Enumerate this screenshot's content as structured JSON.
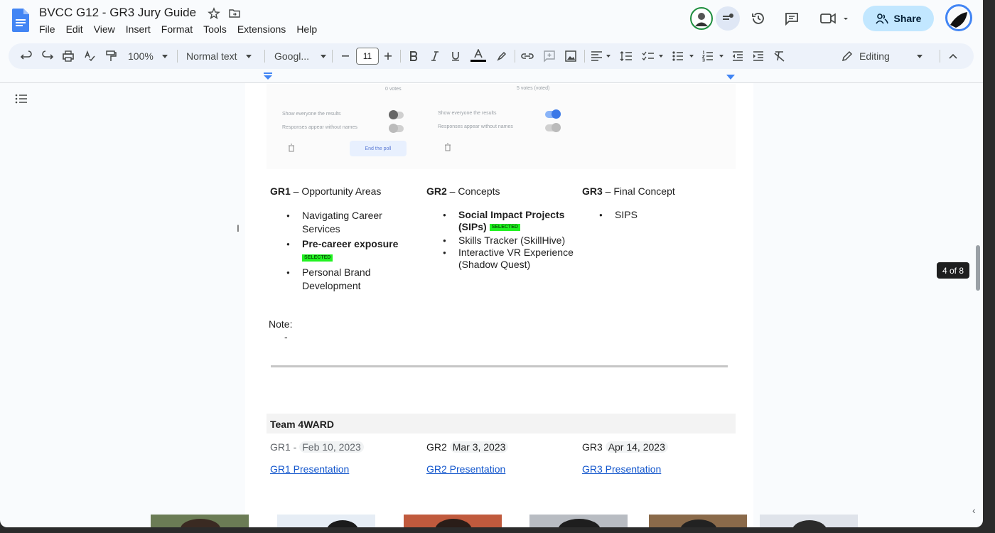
{
  "document": {
    "title": "BVCC G12  - GR3 Jury Guide",
    "menu": [
      "File",
      "Edit",
      "View",
      "Insert",
      "Format",
      "Tools",
      "Extensions",
      "Help"
    ]
  },
  "header": {
    "share_label": "Share"
  },
  "toolbar": {
    "zoom": "100%",
    "style": "Normal text",
    "font": "Googl...",
    "font_size": "11",
    "mode": "Editing"
  },
  "poll": {
    "left_top_label": "0 votes",
    "right_top_label": "5 votes (voted)",
    "left_opt1": "Show everyone the results",
    "left_opt2": "Responses appear without names",
    "right_opt1": "Show everyone the results",
    "right_opt2": "Responses appear without names",
    "end_poll_label": "End the poll"
  },
  "rounds": {
    "gr1": {
      "code": "GR1",
      "title": " – Opportunity Areas",
      "items": [
        {
          "text": "Navigating Career Services",
          "bold": false,
          "selected": false
        },
        {
          "text": "Pre-career exposure",
          "bold": true,
          "selected": true
        },
        {
          "text": "Personal Brand Development",
          "bold": false,
          "selected": false
        }
      ]
    },
    "gr2": {
      "code": "GR2",
      "title": " – Concepts",
      "items": [
        {
          "text": "Social Impact Projects (SIPs)",
          "bold": true,
          "selected": true
        },
        {
          "text": "Skills Tracker (SkillHive)",
          "bold": false,
          "selected": false
        },
        {
          "text": " Interactive VR Experience (Shadow Quest)",
          "bold": false,
          "selected": false
        }
      ]
    },
    "gr3": {
      "code": "GR3",
      "title": " – Final Concept",
      "items": [
        {
          "text": "SIPS",
          "bold": false,
          "selected": false
        }
      ]
    },
    "selected_label": "SELECTED"
  },
  "note": {
    "label": "Note:",
    "bullet": "-"
  },
  "team": {
    "name": "Team 4WARD",
    "gr1_label": "GR1 - ",
    "gr1_date": "Feb 10, 2023",
    "gr2_label": "GR2 ",
    "gr2_date": "Mar 3, 2023",
    "gr3_label": "GR3 ",
    "gr3_date": "Apr 14, 2023",
    "gr1_link": "GR1 Presentation",
    "gr2_link": "GR2 Presentation",
    "gr3_link": "GR3 Presentation"
  },
  "page_indicator": "4 of 8",
  "colors": {
    "accent": "#0b57d0",
    "share_bg": "#c2e7ff",
    "selected_highlight": "#21f321",
    "link": "#1155cc"
  }
}
